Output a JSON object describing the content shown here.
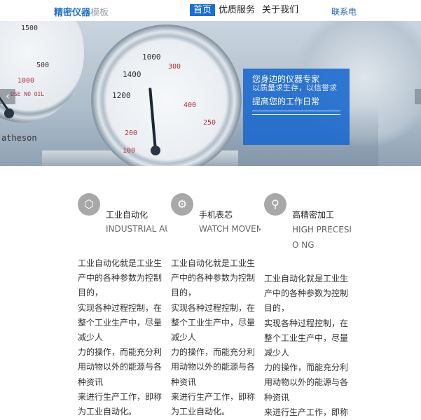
{
  "header": {
    "logo_primary": "精密仪器",
    "logo_secondary": "模板",
    "nav": [
      {
        "label": "首页",
        "active": true
      },
      {
        "label": "优质服务",
        "active": false
      },
      {
        "label": "关于我们",
        "active": false
      }
    ],
    "contact": "联系电"
  },
  "banner": {
    "caption_line1": "您身边的仪器专家",
    "caption_line2": "以质量求生存，以信誉求",
    "caption_line3": "提高您的工作日常",
    "prev_icon": "chevron-left-icon",
    "next_icon": "chevron-right-icon",
    "gauge_ticks": [
      "1500",
      "500",
      "1000",
      "USE NO OIL",
      "atheson",
      "1200",
      "1400",
      "1000",
      "200",
      "300",
      "400",
      "100",
      "250"
    ]
  },
  "features": [
    {
      "icon": "hexagon-nut-icon",
      "title": "工业自动化",
      "subtitle": "INDUSTRIAL AU",
      "desc_lines": [
        "工业自动化就是工业生产中的各种参数为控制目的，",
        "实现各种过程控制，在整个工业生产中，尽量减少人",
        "力的操作，而能充分利用动物以外的能源与各种资讯",
        "来进行生产工作，即称为工业自动化。"
      ]
    },
    {
      "icon": "gears-icon",
      "title": "手机表芯",
      "subtitle": "WATCH MOVEM",
      "desc_lines": [
        "工业自动化就是工业生产中的各种参数为控制目的，",
        "实现各种过程控制，在整个工业生产中，尽量减少人",
        "力的操作，而能充分利用动物以外的能源与各种资讯",
        "来进行生产工作，即称为工业自动化。"
      ]
    },
    {
      "icon": "microscope-icon",
      "title": "高精密加工",
      "subtitle": "HIGH PRECESIO NG",
      "desc_lines": [
        "工业自动化就是工业生产中的各种参数为控制目的，",
        "实现各种过程控制，在整个工业生产中，尽量减少人",
        "力的操作，而能充分利用动物以外的能源与各种资讯",
        "来进行生产工作，即称"
      ]
    }
  ]
}
